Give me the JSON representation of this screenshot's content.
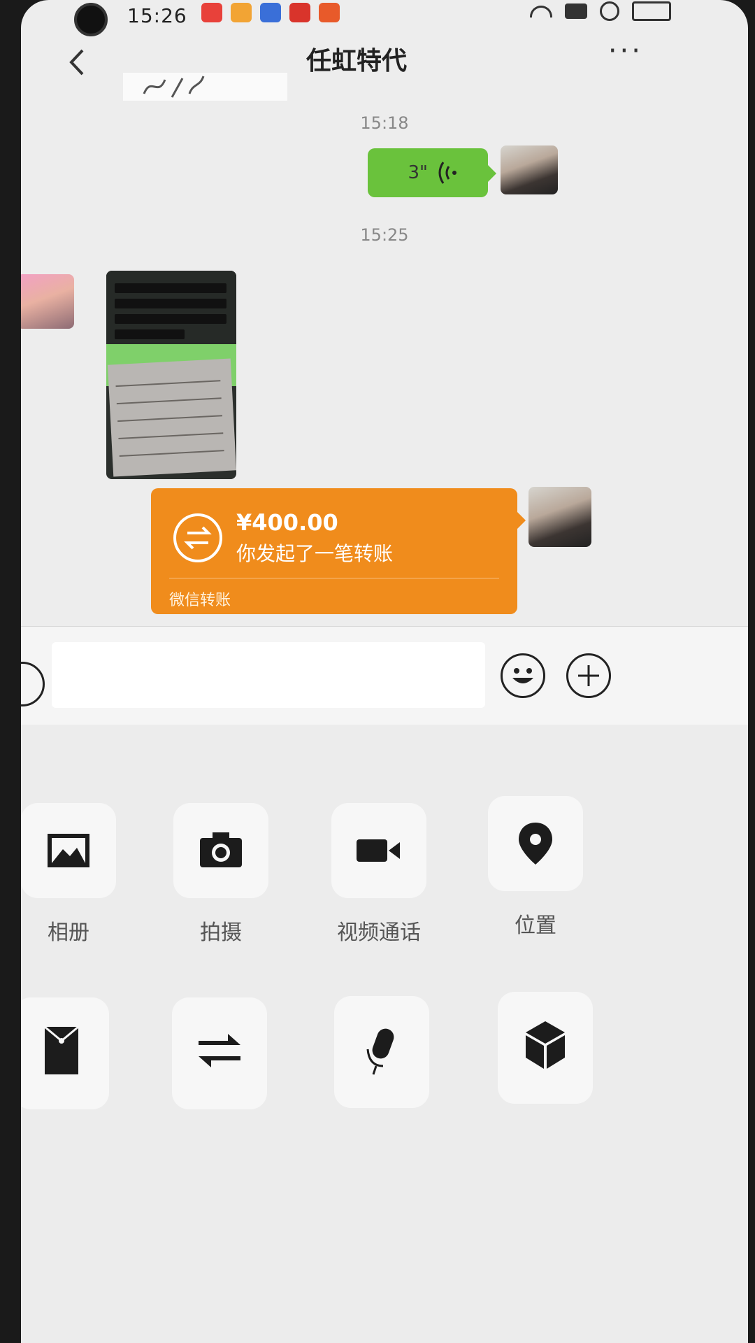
{
  "status_bar": {
    "time": "15:26"
  },
  "nav": {
    "title": "任虹特代"
  },
  "messages": {
    "timestamp_1": "15:18",
    "voice_duration": "3\"",
    "timestamp_2": "15:25",
    "transfer": {
      "amount": "¥400.00",
      "description": "你发起了一笔转账",
      "footer": "微信转账"
    }
  },
  "panel": {
    "items": [
      {
        "label": "相册",
        "icon": "photo-album-icon"
      },
      {
        "label": "拍摄",
        "icon": "camera-icon"
      },
      {
        "label": "视频通话",
        "icon": "video-call-icon"
      },
      {
        "label": "位置",
        "icon": "location-pin-icon"
      },
      {
        "label": "",
        "icon": "red-packet-icon"
      },
      {
        "label": "",
        "icon": "transfer-icon"
      },
      {
        "label": "",
        "icon": "voice-input-icon"
      },
      {
        "label": "",
        "icon": "box-icon"
      }
    ]
  },
  "colors": {
    "voice_bubble": "#6ac23c",
    "transfer_card": "#f08c1c",
    "chat_bg": "#ededed"
  }
}
